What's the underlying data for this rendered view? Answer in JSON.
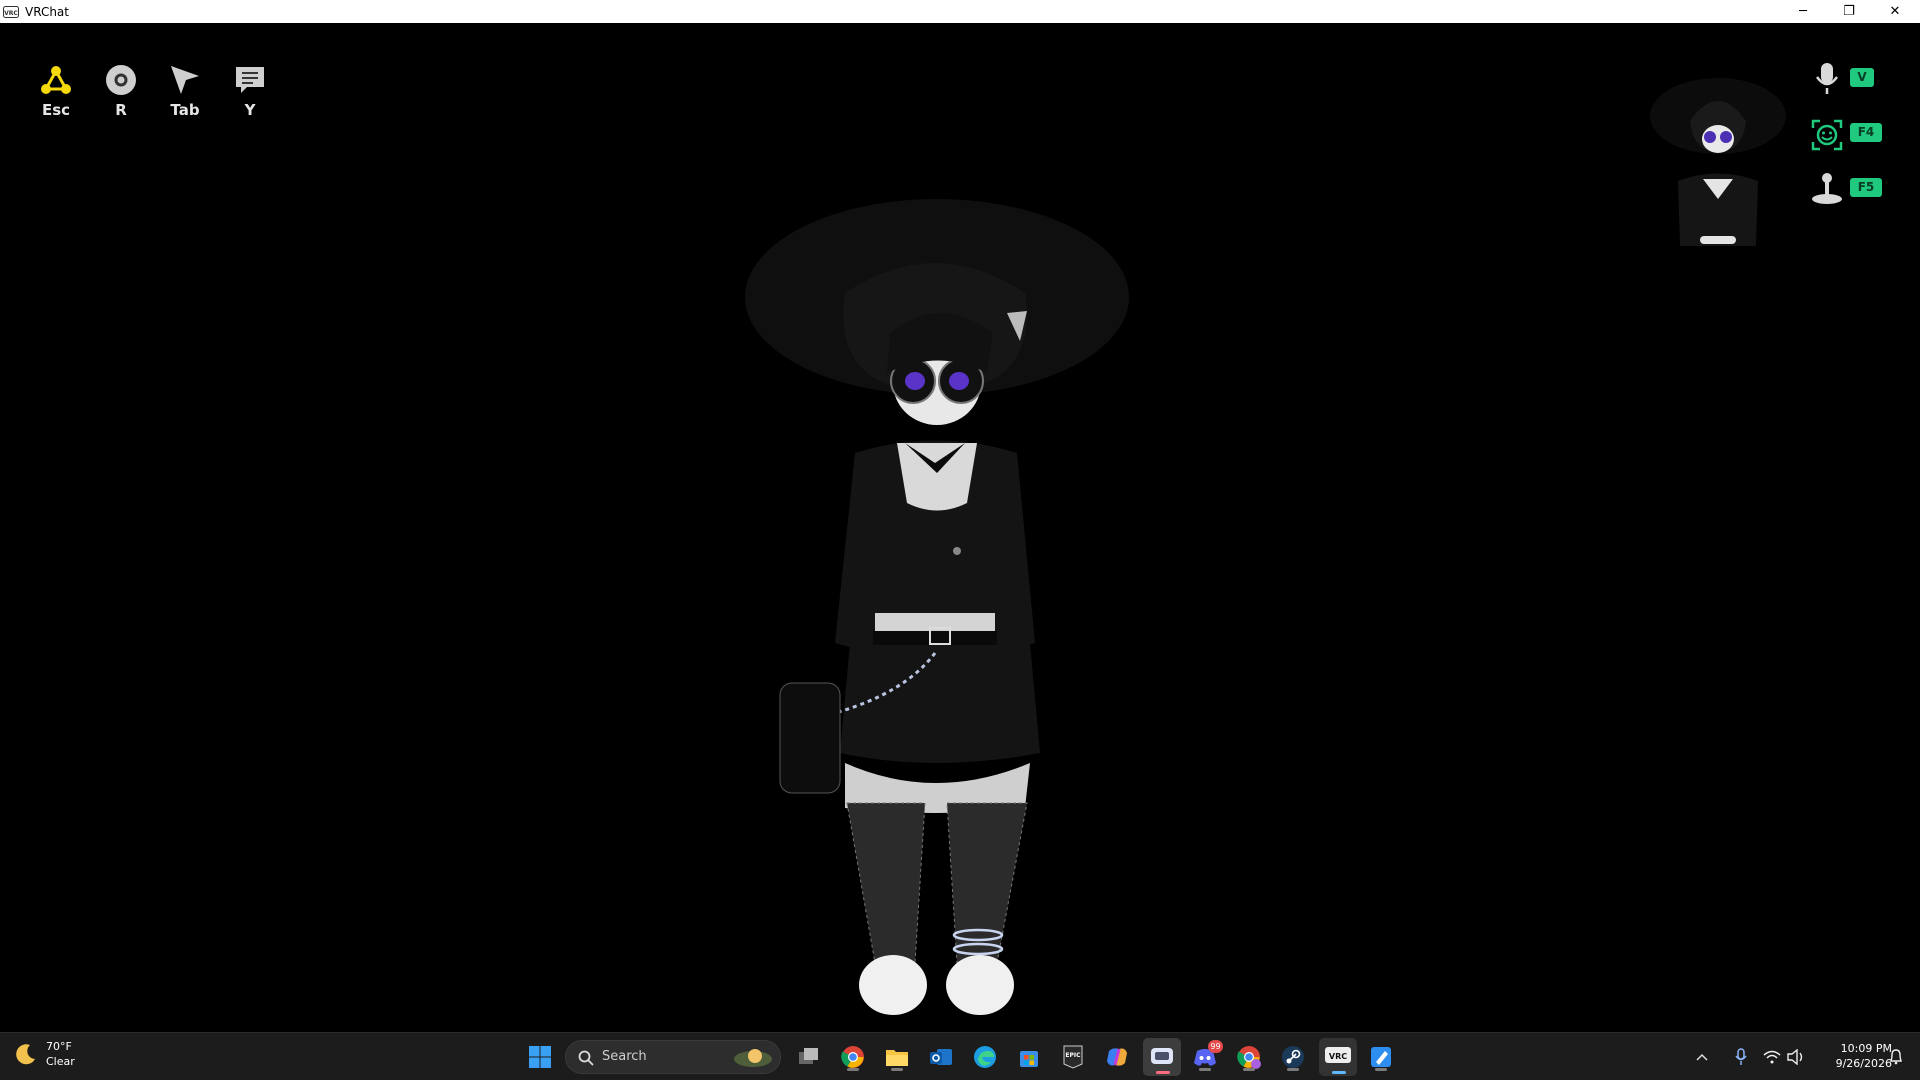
{
  "window": {
    "title": "VRChat",
    "minimize_glyph": "─",
    "restore_glyph": "❐",
    "close_glyph": "✕"
  },
  "hud": {
    "menu_buttons": [
      {
        "icon": "quick-menu-icon",
        "key": "Esc",
        "color": "#f5d90a"
      },
      {
        "icon": "camera-icon",
        "key": "R"
      },
      {
        "icon": "pointer-icon",
        "key": "Tab"
      },
      {
        "icon": "chat-icon",
        "key": "Y"
      }
    ],
    "status": [
      {
        "icon": "microphone-icon",
        "key": "V"
      },
      {
        "icon": "face-tracking-icon",
        "key": "F4"
      },
      {
        "icon": "joystick-icon",
        "key": "F5"
      }
    ],
    "accent_color": "#1fc97e"
  },
  "taskbar": {
    "weather": {
      "temp": "70°F",
      "condition": "Clear",
      "icon": "moon-icon"
    },
    "search_placeholder": "Search",
    "apps": [
      "windows-start-icon",
      "search-icon",
      "task-view-icon",
      "chrome-icon",
      "file-explorer-icon",
      "outlook-icon",
      "edge-icon",
      "microsoft-store-icon",
      "epic-games-icon",
      "copilot-icon",
      "vrchat-launcher-icon",
      "discord-icon",
      "chrome-profile-icon",
      "steam-icon",
      "vrchat-icon",
      "paint-icon"
    ],
    "discord_badge": "99",
    "epic_label": "EPIC",
    "vrc_label": "VRC",
    "clock": {
      "time": "10:09 PM",
      "date": "9/26/2026"
    }
  }
}
